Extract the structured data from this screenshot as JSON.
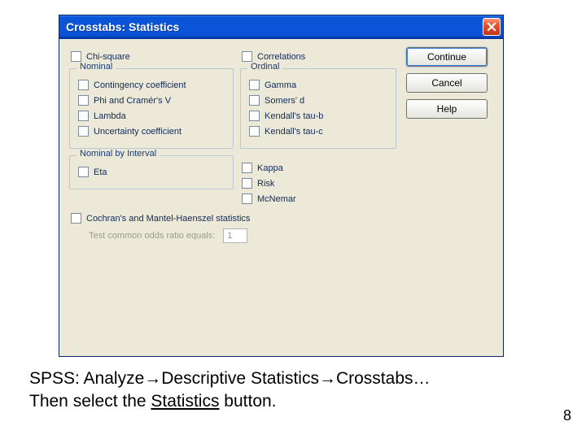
{
  "titlebar": {
    "title": "Crosstabs: Statistics"
  },
  "top_row": {
    "chi_square": "Chi-square",
    "correlations": "Correlations"
  },
  "nominal": {
    "legend": "Nominal",
    "items": [
      "Contingency coefficient",
      "Phi and Cramér's V",
      "Lambda",
      "Uncertainty coefficient"
    ]
  },
  "ordinal": {
    "legend": "Ordinal",
    "items": [
      "Gamma",
      "Somers' d",
      "Kendall's tau-b",
      "Kendall's tau-c"
    ]
  },
  "nominal_by_interval": {
    "legend": "Nominal by Interval",
    "items": [
      "Eta"
    ]
  },
  "right_stack": [
    "Kappa",
    "Risk",
    "McNemar"
  ],
  "cochran": "Cochran's and Mantel-Haenszel statistics",
  "odds": {
    "label": "Test common odds ratio equals:",
    "value": "1"
  },
  "buttons": {
    "continue": "Continue",
    "cancel": "Cancel",
    "help": "Help"
  },
  "caption": {
    "line1_a": "SPSS: Analyze",
    "line1_b": "Descriptive Statistics",
    "line1_c": "Crosstabs…",
    "line2_a": "Then select the ",
    "line2_u": "Statistics",
    "line2_b": " button."
  },
  "page_number": "8"
}
